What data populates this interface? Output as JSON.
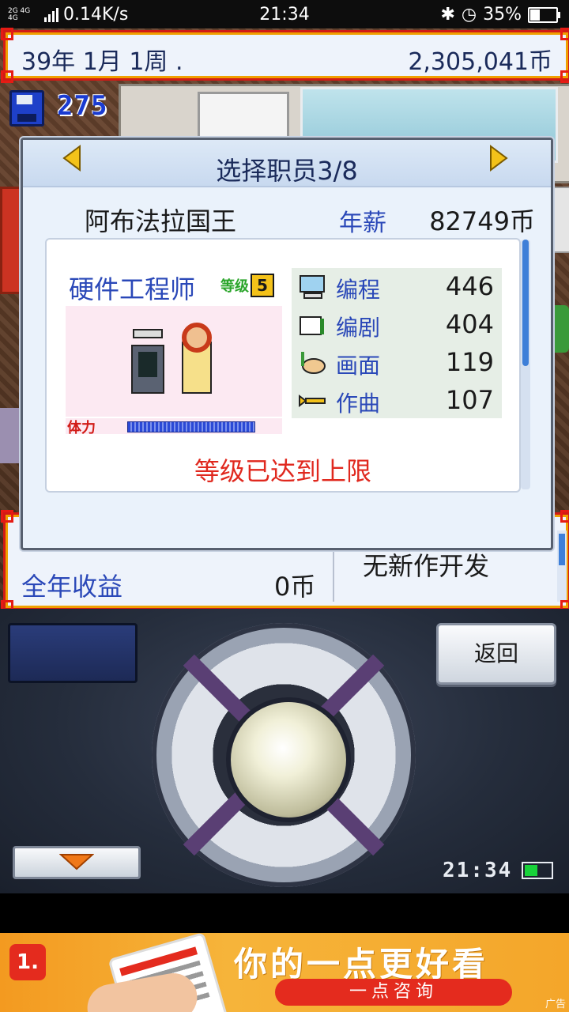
{
  "status_bar": {
    "network": "2G 4G 4G",
    "speed": "0.14K/s",
    "time": "21:34",
    "battery": "35%"
  },
  "top_bar": {
    "date": "39年 1月 1周 .",
    "money": "2,305,041币"
  },
  "research_points": "275",
  "dialog": {
    "title": "选择职员3/8",
    "employee_name": "阿布法拉国王",
    "salary_label": "年薪",
    "salary_value": "82749币",
    "job_title": "硬件工程师",
    "level_label": "等级",
    "level_value": "5",
    "stamina_label": "体力",
    "stats": [
      {
        "icon": "computer-icon",
        "label": "编程",
        "value": "446"
      },
      {
        "icon": "script-book-icon",
        "label": "编剧",
        "value": "404"
      },
      {
        "icon": "paint-palette-icon",
        "label": "画面",
        "value": "119"
      },
      {
        "icon": "trumpet-icon",
        "label": "作曲",
        "value": "107"
      }
    ],
    "notice": "等级已达到上限"
  },
  "lower_panel": {
    "annual_income_label": "全年收益",
    "annual_income_value": "0币",
    "dev_status": "无新作开发"
  },
  "controller": {
    "back_label": "返回",
    "clock": "21:34"
  },
  "ad": {
    "logo": "1.",
    "headline": "你的一点更好看",
    "cta": "一点咨询",
    "tag": "广告"
  },
  "colors": {
    "frame_red": "#d11b16",
    "frame_gold": "#f0a000",
    "text_blue": "#2a48b8",
    "notice_red": "#e0281e",
    "ad_orange": "#f39a20"
  }
}
